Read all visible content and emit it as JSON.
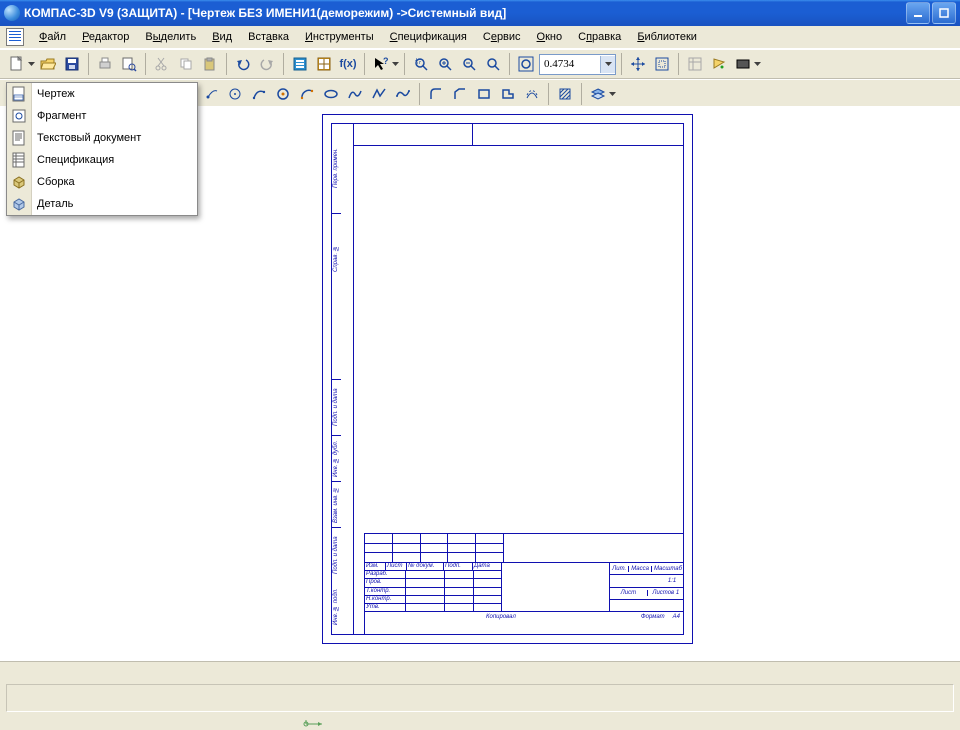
{
  "title": "КОМПАС-3D V9 (ЗАЩИТА) - [Чертеж БЕЗ ИМЕНИ1(деморежим) ->Системный вид]",
  "menus": {
    "file": "Файл",
    "edit": "Редактор",
    "select": "Выделить",
    "view": "Вид",
    "insert": "Вставка",
    "tools": "Инструменты",
    "spec": "Спецификация",
    "service": "Сервис",
    "window": "Окно",
    "help": "Справка",
    "libs": "Библиотеки"
  },
  "toolbar": {
    "zoom_value": "0.4734"
  },
  "new_menu": {
    "drawing": "Чертеж",
    "fragment": "Фрагмент",
    "textdoc": "Текстовый документ",
    "spec": "Спецификация",
    "assembly": "Сборка",
    "part": "Деталь"
  },
  "stamp": {
    "col_izm": "Изм.",
    "col_list": "Лист",
    "col_ndok": "№ докум.",
    "col_podp": "Подп.",
    "col_data": "Дата",
    "r_razrab": "Разраб.",
    "r_prov": "Пров.",
    "r_tkontr": "Т.контр.",
    "r_nkontr": "Н.контр.",
    "r_utv": "Утв.",
    "lit": "Лит.",
    "massa": "Масса",
    "mashtab": "Масштаб",
    "scale": "1:1",
    "list": "Лист",
    "listov": "Листов",
    "listov_v": "1",
    "kopiroval": "Копировал",
    "format": "Формат",
    "format_v": "A4"
  },
  "sidecells": {
    "a": "Перв. примен.",
    "b": "Справ. №",
    "c": "Подп. и дата",
    "d": "Инв. № дубл.",
    "e": "Взам. инв. №",
    "f": "Подп. и дата",
    "g": "Инв. № подл."
  }
}
